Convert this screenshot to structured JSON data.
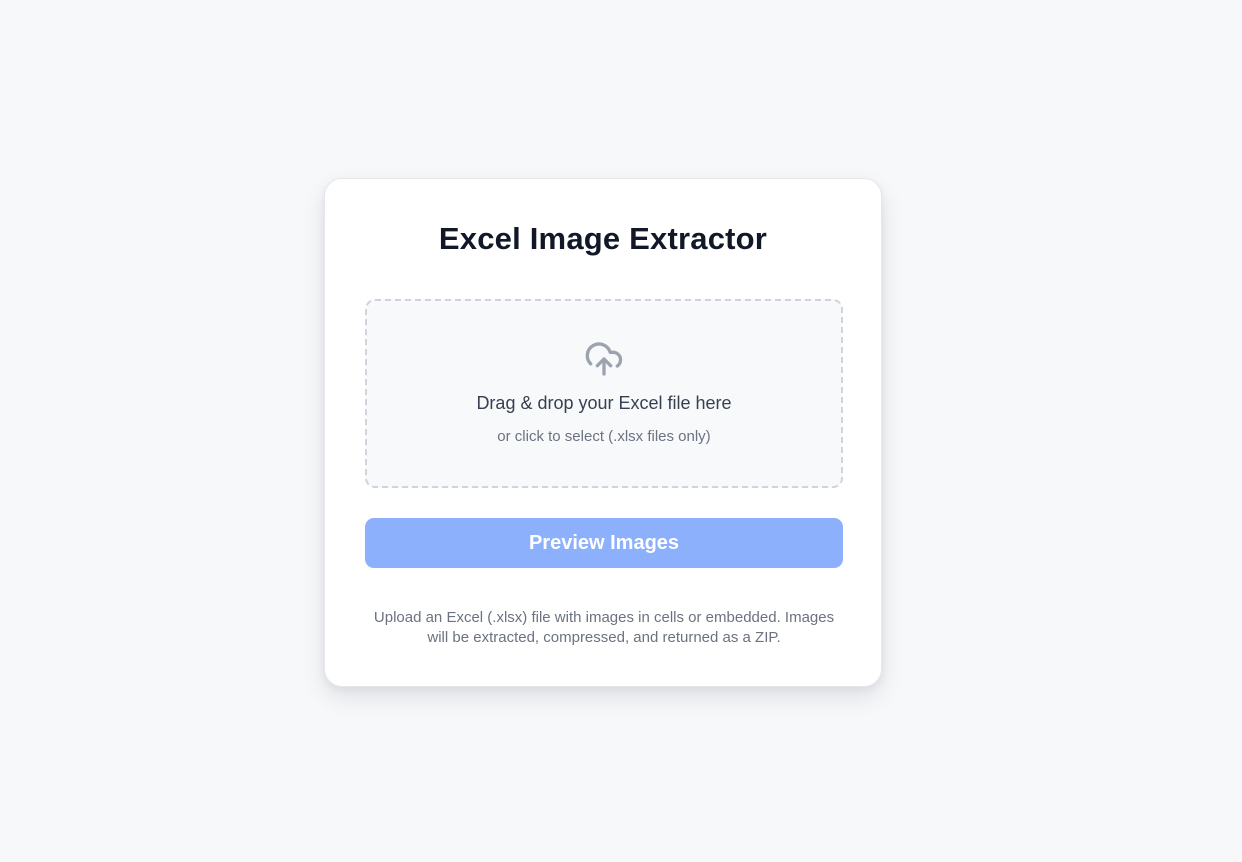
{
  "app": {
    "title": "Excel Image Extractor"
  },
  "dropzone": {
    "icon": "cloud-upload-icon",
    "primary_text": "Drag & drop your Excel file here",
    "secondary_text": "or click to select (.xlsx files only)"
  },
  "actions": {
    "preview_label": "Preview Images",
    "preview_enabled": false
  },
  "info": {
    "text": "Upload an Excel (.xlsx) file with images in cells or embedded. Images will be extracted, compressed, and returned as a ZIP."
  },
  "colors": {
    "background": "#f7f8fa",
    "card": "#ffffff",
    "title": "#111827",
    "button_disabled": "#8cb0fb",
    "muted_text": "#6b7280",
    "icon": "#9ca3af"
  }
}
